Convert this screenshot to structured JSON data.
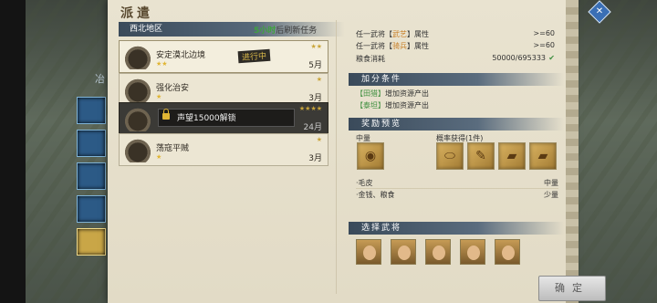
{
  "panel": {
    "title": "派遣",
    "region": "西北地区",
    "refresh_highlight": "5小时",
    "refresh_text": "后刷新任务",
    "side_text": "冶"
  },
  "tasks": [
    {
      "name": "安定漠北边境",
      "duration": "5月",
      "stars": "★★",
      "rstars": "★★",
      "status": "进行中"
    },
    {
      "name": "强化治安",
      "duration": "3月",
      "stars": "★",
      "rstars": "★"
    },
    {
      "name": "",
      "duration": "24月",
      "stars": "",
      "rstars": "★★★★",
      "lock_text": "声望15000解锁"
    },
    {
      "name": "荡寇平贼",
      "duration": "3月",
      "stars": "★",
      "rstars": "★"
    }
  ],
  "requirements": [
    {
      "text_a": "任一武将【",
      "tag": "武艺",
      "text_b": "】属性",
      "value": ">=60"
    },
    {
      "text_a": "任一武将【",
      "tag": "骑兵",
      "text_b": "】属性",
      "value": ">=60"
    },
    {
      "text_a": "粮食消耗",
      "tag": "",
      "text_b": "",
      "value": "50000/695333"
    }
  ],
  "bonus": {
    "title": "加分条件",
    "items": [
      {
        "tag": "【田猎】",
        "text": "增加资源产出"
      },
      {
        "tag": "【泰坦】",
        "text": "增加资源产出"
      }
    ]
  },
  "reward": {
    "title": "奖励预览",
    "guaranteed": "中量",
    "chance": "概率获得(1件)",
    "drops": [
      {
        "name": "·毛皮",
        "amount": "中量"
      },
      {
        "name": "·金钱、粮食",
        "amount": "少量"
      }
    ]
  },
  "generals": {
    "title": "选择武将"
  },
  "confirm_label": "确定",
  "icons": {
    "close": "close-icon",
    "lock": "lock-icon",
    "check": "check-icon"
  }
}
